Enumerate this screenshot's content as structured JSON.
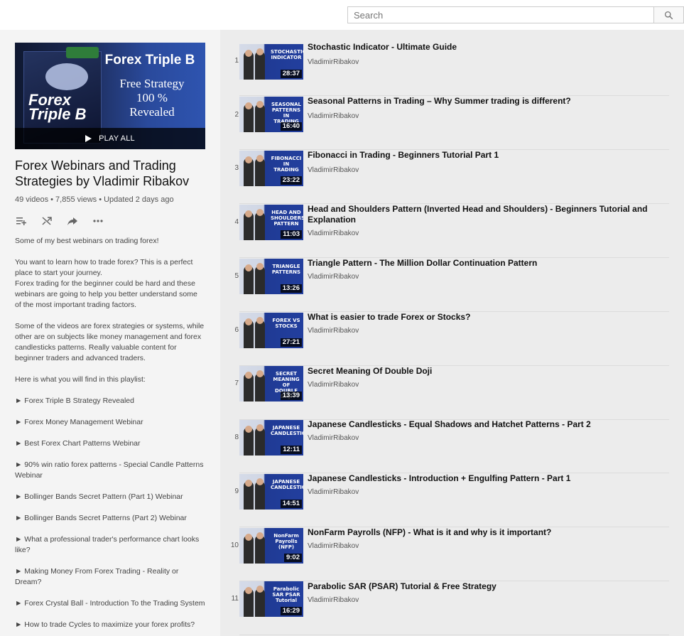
{
  "search": {
    "placeholder": "Search"
  },
  "playlist": {
    "thumbnail": {
      "brand": "Forex Triple B",
      "lines": [
        "Free Strategy",
        "100 %",
        "Revealed"
      ],
      "box_text": "Forex Triple B"
    },
    "play_all_label": "PLAY ALL",
    "title": "Forex Webinars and Trading Strategies by Vladimir Ribakov",
    "meta": "49 videos • 7,855 views • Updated 2 days ago",
    "description": {
      "paragraphs": [
        "Some of my best webinars on trading forex!",
        "You want to learn how to trade forex? This is a perfect place to start your journey.\nForex trading for the beginner could be hard and these webinars are going to help you better understand some of the most important trading factors.",
        "Some of the videos are forex strategies or systems, while other are on subjects like money management and forex candlesticks patterns. Really valuable content for beginner traders and advanced traders.",
        "Here is what you will find in this playlist:"
      ],
      "bullets": [
        "► Forex Triple B Strategy Revealed",
        "► Forex Money Management Webinar",
        "► Best Forex Chart Patterns Webinar",
        "► 90% win ratio forex patterns - Special Candle Patterns Webinar",
        "► Bollinger Bands Secret Pattern (Part 1) Webinar",
        "► Bollinger Bands Secret Patterns (Part 2) Webinar",
        "► What a professional trader's performance chart looks like?",
        "► Making Money From Forex Trading - Reality or Dream?",
        "► Forex Crystal Ball - Introduction To the Trading System",
        "► How to trade Cycles to maximize your forex profits?"
      ]
    }
  },
  "videos": [
    {
      "index": "1",
      "title": "Stochastic Indicator - Ultimate Guide",
      "channel": "VladimirRibakov",
      "duration": "28:37",
      "thumb_label": "STOCHASTIC INDICATOR"
    },
    {
      "index": "2",
      "title": "Seasonal Patterns in Trading – Why Summer trading is different?",
      "channel": "VladimirRibakov",
      "duration": "16:40",
      "thumb_label": "SEASONAL PATTERNS IN TRADING"
    },
    {
      "index": "3",
      "title": "Fibonacci in Trading - Beginners Tutorial Part 1",
      "channel": "VladimirRibakov",
      "duration": "23:22",
      "thumb_label": "FIBONACCI IN TRADING"
    },
    {
      "index": "4",
      "title": "Head and Shoulders Pattern (Inverted Head and Shoulders) - Beginners Tutorial and Explanation",
      "channel": "VladimirRibakov",
      "duration": "11:03",
      "thumb_label": "HEAD AND SHOULDERS PATTERN"
    },
    {
      "index": "5",
      "title": "Triangle Pattern - The Million Dollar Continuation Pattern",
      "channel": "VladimirRibakov",
      "duration": "13:26",
      "thumb_label": "TRIANGLE PATTERNS"
    },
    {
      "index": "6",
      "title": "What is easier to trade Forex or Stocks?",
      "channel": "VladimirRibakov",
      "duration": "27:21",
      "thumb_label": "FOREX VS STOCKS"
    },
    {
      "index": "7",
      "title": "Secret Meaning Of Double Doji",
      "channel": "VladimirRibakov",
      "duration": "13:39",
      "thumb_label": "SECRET MEANING OF DOUBLE DOJI"
    },
    {
      "index": "8",
      "title": "Japanese Candlesticks - Equal Shadows and Hatchet Patterns - Part 2",
      "channel": "VladimirRibakov",
      "duration": "12:11",
      "thumb_label": "JAPANESE CANDLESTICKS"
    },
    {
      "index": "9",
      "title": "Japanese Candlesticks - Introduction + Engulfing Pattern - Part 1",
      "channel": "VladimirRibakov",
      "duration": "14:51",
      "thumb_label": "JAPANESE CANDLESTICKS"
    },
    {
      "index": "10",
      "title": "NonFarm Payrolls (NFP) - What is it and why is it important?",
      "channel": "VladimirRibakov",
      "duration": "9:02",
      "thumb_label": "NonFarm Payrolls (NFP)"
    },
    {
      "index": "11",
      "title": "Parabolic SAR (PSAR) Tutorial & Free Strategy",
      "channel": "VladimirRibakov",
      "duration": "16:29",
      "thumb_label": "Parabolic SAR PSAR Tutorial"
    }
  ],
  "icons": {
    "search": "search-icon",
    "add_to_queue": "add-to-queue-icon",
    "shuffle": "shuffle-icon",
    "share": "share-icon",
    "more": "more-icon"
  }
}
